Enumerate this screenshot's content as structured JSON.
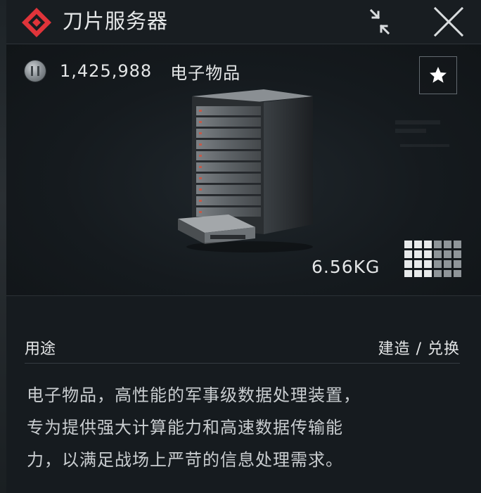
{
  "header": {
    "title": "刀片服务器",
    "logo_icon": "diamond-logo-icon",
    "collapse_icon": "collapse-arrows-icon",
    "close_icon": "close-x-icon",
    "accent_color": "#e0343a"
  },
  "item": {
    "price": "1,425,988",
    "currency_icon": "silver-coin-icon",
    "category": "电子物品",
    "favorite_icon": "star-icon",
    "image_icon": "blade-server-icon",
    "weight": "6.56KG",
    "size_grid": {
      "icon": "inventory-grid-icon",
      "columns": 6,
      "rows": 4,
      "filled_columns": 3
    }
  },
  "details": {
    "usage_label": "用途",
    "usage_value": "建造 / 兑换",
    "description_lines": [
      "电子物品，高性能的军事级数据处理装置，",
      "专为提供强大计算能力和高速数据传输能",
      "力，以满足战场上严苛的信息处理需求。"
    ]
  }
}
